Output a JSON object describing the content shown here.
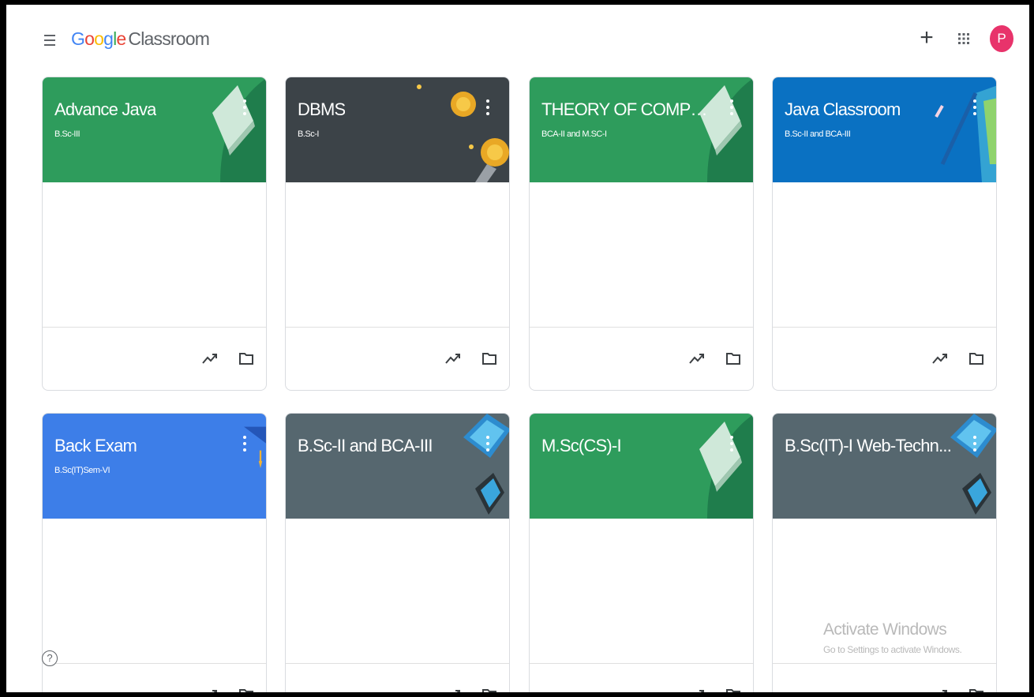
{
  "app": {
    "logo_google": [
      "G",
      "o",
      "o",
      "g",
      "l",
      "e"
    ],
    "logo_product": "Classroom",
    "plus_label": "+",
    "avatar_letter": "P"
  },
  "cards": [
    {
      "title": "Advance Java",
      "subtitle": "B.Sc-III",
      "color": "#2e9c5c",
      "theme": "book-green"
    },
    {
      "title": "DBMS",
      "subtitle": "B.Sc-I",
      "color": "#3c4348",
      "theme": "coins-dark"
    },
    {
      "title": "THEORY OF COMPUT...",
      "subtitle": "BCA-II and M.SC-I",
      "color": "#2e9c5c",
      "theme": "book-green"
    },
    {
      "title": "Java Classroom",
      "subtitle": "B.Sc-II and BCA-III",
      "color": "#0a71c2",
      "theme": "pencil-blue"
    },
    {
      "title": "Back Exam",
      "subtitle": "B.Sc(IT)Sem-VI",
      "color": "#3d7ee8",
      "theme": "cap-blue"
    },
    {
      "title": "B.Sc-II and BCA-III",
      "subtitle": "",
      "color": "#56676f",
      "theme": "devices-gray"
    },
    {
      "title": "M.Sc(CS)-I",
      "subtitle": "",
      "color": "#2e9c5c",
      "theme": "book-green"
    },
    {
      "title": "B.Sc(IT)-I Web-Techn...",
      "subtitle": "",
      "color": "#56676f",
      "theme": "devices-gray"
    }
  ],
  "help": {
    "label": "?"
  },
  "watermark": {
    "line1": "Activate Windows",
    "line2": "Go to Settings to activate Windows."
  }
}
